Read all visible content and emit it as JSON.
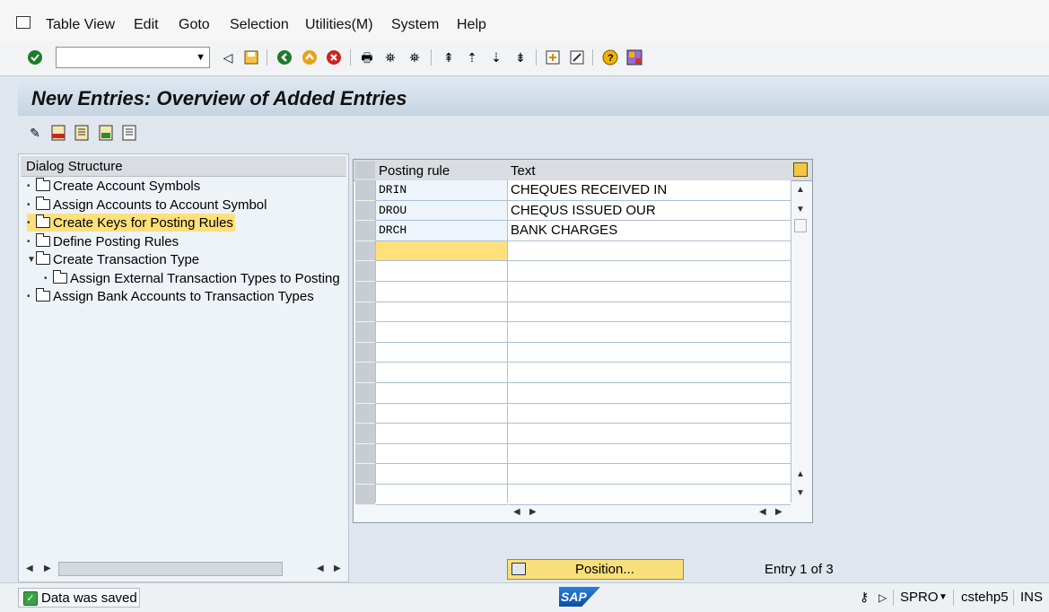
{
  "menu": {
    "items": [
      "Table View",
      "Edit",
      "Goto",
      "Selection",
      "Utilities(M)",
      "System",
      "Help"
    ]
  },
  "toolbar": {
    "command_field_value": "",
    "icons": [
      "enter-icon",
      "back-icon",
      "save-icon",
      "back-nav-icon",
      "exit-icon",
      "cancel-icon",
      "print-icon",
      "find-icon",
      "find-next-icon",
      "first-page-icon",
      "prev-page-icon",
      "next-page-icon",
      "last-page-icon",
      "new-session-icon",
      "shortcut-icon",
      "help-icon",
      "layout-icon"
    ]
  },
  "title": "New Entries: Overview of Added Entries",
  "dialog_structure": {
    "header": "Dialog Structure",
    "nodes": [
      {
        "label": "Create Account Symbols",
        "selected": false
      },
      {
        "label": "Assign Accounts to Account Symbol",
        "selected": false
      },
      {
        "label": "Create Keys for Posting Rules",
        "selected": true
      },
      {
        "label": "Define Posting Rules",
        "selected": false
      },
      {
        "label": "Create Transaction Type",
        "selected": false,
        "expanded": true
      },
      {
        "label": "Assign External Transaction Types to Posting",
        "selected": false,
        "child": true
      },
      {
        "label": "Assign Bank Accounts to Transaction Types",
        "selected": false
      }
    ]
  },
  "table": {
    "columns": [
      "Posting rule",
      "Text"
    ],
    "rows": [
      {
        "posting_rule": "DRIN",
        "text": "CHEQUES RECEIVED IN"
      },
      {
        "posting_rule": "DROU",
        "text": "CHEQUS ISSUED OUR"
      },
      {
        "posting_rule": "DRCH",
        "text": "BANK CHARGES"
      }
    ]
  },
  "position_button": "Position...",
  "entry_info": "Entry 1 of 3",
  "status": {
    "message": "Data was saved",
    "transaction": "SPRO",
    "system": "cstehp5",
    "mode": "INS"
  },
  "colors": {
    "selection": "#ffe07a",
    "title_bar": "#c6d4e2",
    "accent_blue": "#0b4ea6"
  }
}
